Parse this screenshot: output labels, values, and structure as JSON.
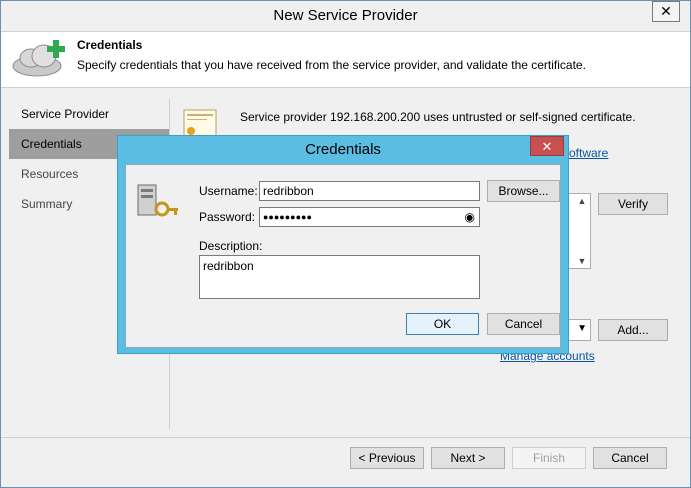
{
  "window": {
    "title": "New Service Provider",
    "close_glyph": "✕"
  },
  "header": {
    "title": "Credentials",
    "description": "Specify credentials that you have received from the service provider, and validate the certificate.",
    "icon": "cloud-add-icon"
  },
  "sidebar": {
    "items": [
      {
        "label": "Service Provider"
      },
      {
        "label": "Credentials"
      },
      {
        "label": "Resources"
      },
      {
        "label": "Summary"
      }
    ]
  },
  "content": {
    "cert_message": "Service provider 192.168.200.200 uses untrusted or self-signed certificate.",
    "link_partial": "oftware",
    "verify_label": "Verify",
    "add_label": "Add...",
    "manage_accounts_label": "Manage accounts"
  },
  "dialog": {
    "title": "Credentials",
    "close_glyph": "✕",
    "username_label": "Username:",
    "username_value": "redribbon",
    "browse_label": "Browse...",
    "password_label": "Password:",
    "password_mask": "●●●●●●●●●",
    "description_label": "Description:",
    "description_value": "redribbon",
    "ok_label": "OK",
    "cancel_label": "Cancel"
  },
  "footer": {
    "previous_label": "< Previous",
    "next_label": "Next >",
    "finish_label": "Finish",
    "cancel_label": "Cancel"
  },
  "colors": {
    "dialog_frame": "#5bbde2",
    "selected_item": "#9e9e9e",
    "close_red": "#c75050",
    "link": "#0a54a6"
  }
}
